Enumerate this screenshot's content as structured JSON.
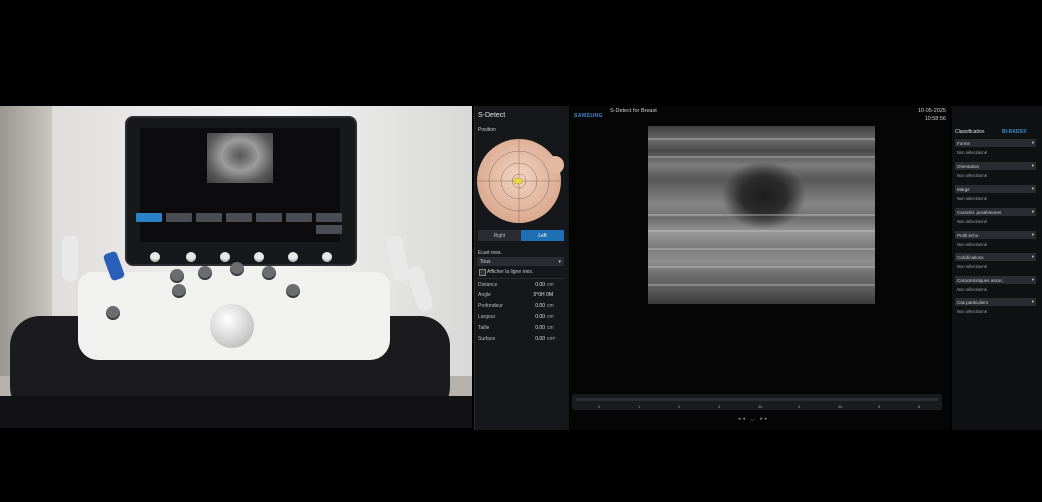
{
  "colors": {
    "accent": "#1f6fb5",
    "brand": "#3d8fd6",
    "panel": "#16171a"
  },
  "sdetect": {
    "title": "S-Detect",
    "position_label": "Position",
    "side_buttons": {
      "right": "Right",
      "left": "Left"
    },
    "ecart_label": "Ecart mes.",
    "ecart_value": "Tous",
    "checkbox_label": "Afficher la ligne mes.",
    "measurements": [
      {
        "label": "Distance",
        "value": "0.00",
        "unit": "cm"
      },
      {
        "label": "Angle",
        "value": "0°0H 0M",
        "unit": ""
      },
      {
        "label": "Profondeur",
        "value": "0.00",
        "unit": "cm"
      },
      {
        "label": "Largeur",
        "value": "0.00",
        "unit": "cm"
      },
      {
        "label": "Taille",
        "value": "0.00",
        "unit": "cm"
      },
      {
        "label": "Surface",
        "value": "0.00",
        "unit": "cm²"
      }
    ]
  },
  "image": {
    "brand": "SAMSUNG",
    "title": "S-Detect for Breast",
    "date": "10-05-2025",
    "time": "10:58:56",
    "cine_ticks": [
      "0",
      "1",
      "2",
      "3",
      "3b",
      "4",
      "4b",
      "5",
      "6"
    ]
  },
  "classification": {
    "title": "Classification",
    "birads": "BI-RADS®",
    "fields": [
      {
        "label": "Forme",
        "value": "Non sélectionné"
      },
      {
        "label": "Orientation",
        "value": "Non sélectionné"
      },
      {
        "label": "Marge",
        "value": "Non sélectionné"
      },
      {
        "label": "Caractér. postérieures",
        "value": "Non sélectionné"
      },
      {
        "label": "Profil écho",
        "value": "Non sélectionné"
      },
      {
        "label": "Calcifications",
        "value": "Non sélectionné"
      },
      {
        "label": "Caractéristiques assoc.",
        "value": "Non sélectionné"
      },
      {
        "label": "Cas particuliers",
        "value": "Non sélectionné"
      }
    ]
  }
}
